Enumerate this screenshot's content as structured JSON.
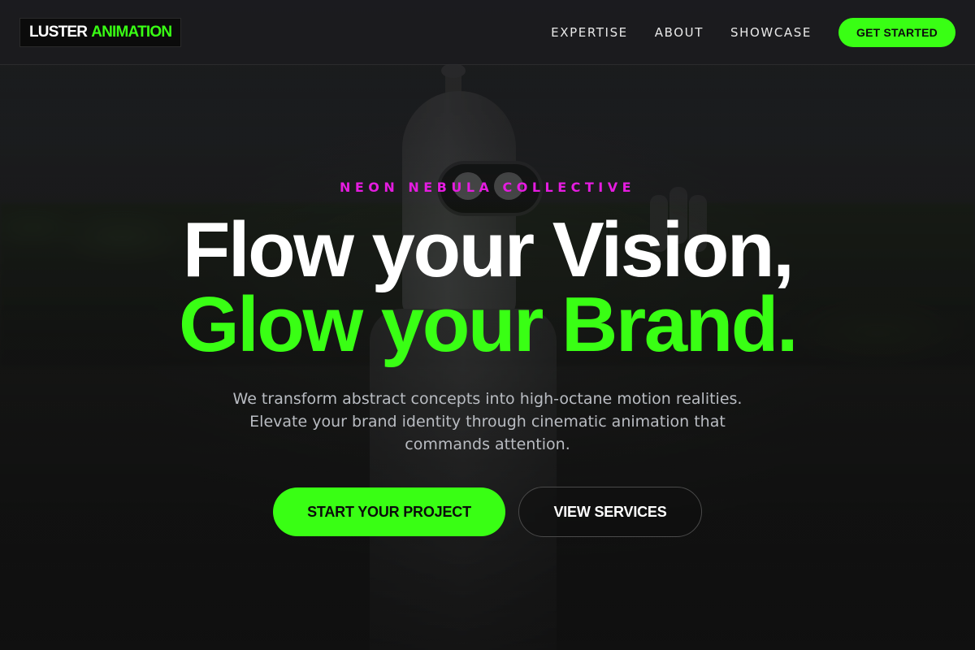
{
  "brand": {
    "logo_word1": "LUSTER",
    "logo_word2": "ANIMATION"
  },
  "nav": {
    "links": [
      "EXPERTISE",
      "ABOUT",
      "SHOWCASE"
    ],
    "cta_label": "GET STARTED"
  },
  "hero": {
    "eyebrow": "NEON NEBULA COLLECTIVE",
    "headline_line1": "Flow your Vision,",
    "headline_line2": "Glow your Brand.",
    "subtext": "We transform abstract concepts into high-octane motion realities. Elevate your brand identity through cinematic animation that commands attention.",
    "primary_button": "START YOUR PROJECT",
    "secondary_button": "VIEW SERVICES"
  },
  "colors": {
    "accent_green": "#39ff14",
    "accent_magenta": "#e51ce0",
    "nav_bg": "#1c1c20",
    "page_bg": "#141414"
  }
}
